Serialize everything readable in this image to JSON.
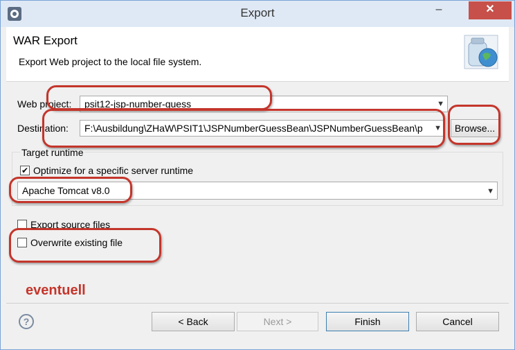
{
  "window": {
    "title": "Export",
    "minimize_glyph": "–",
    "close_glyph": "✕"
  },
  "header": {
    "title": "WAR Export",
    "description": "Export Web project to the local file system."
  },
  "form": {
    "web_project_label": "Web project:",
    "web_project_value": "psit12-jsp-number-guess",
    "destination_label": "Destination:",
    "destination_value": "F:\\Ausbildung\\ZHaW\\PSIT1\\JSPNumberGuessBean\\JSPNumberGuessBean\\p",
    "browse_label": "Browse...",
    "target_runtime_label": "Target runtime",
    "optimize_label": "Optimize for a specific server runtime",
    "optimize_checked": true,
    "runtime_value": "Apache Tomcat v8.0",
    "export_source_label": "Export source files",
    "export_source_checked": false,
    "overwrite_label": "Overwrite existing file",
    "overwrite_checked": false
  },
  "annotation": {
    "note": "eventuell",
    "color": "#c4352b"
  },
  "footer": {
    "help_glyph": "?",
    "back_label": "< Back",
    "next_label": "Next >",
    "finish_label": "Finish",
    "cancel_label": "Cancel"
  },
  "icons": [
    "eclipse-app-icon",
    "jar-globe-icon",
    "help-icon",
    "chevron-down-icon",
    "checkmark-icon"
  ]
}
